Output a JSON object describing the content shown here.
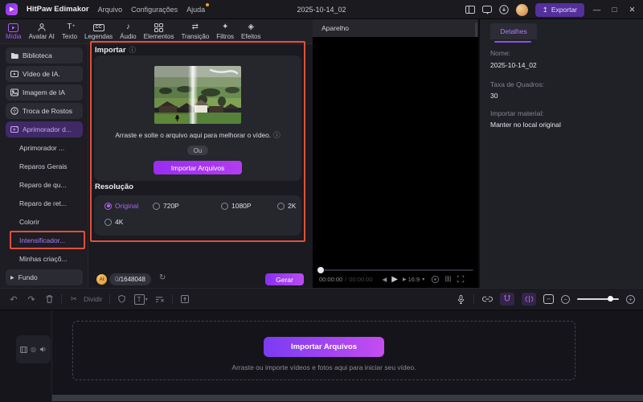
{
  "titlebar": {
    "app_name": "HitPaw Edimakor",
    "menus": [
      "Arquivo",
      "Configurações",
      "Ajuda"
    ],
    "project_title": "2025-10-14_02",
    "export_label": "Exportar"
  },
  "tabs": [
    "Mídia",
    "Avatar AI",
    "Texto",
    "Legendas",
    "Áudio",
    "Elementos",
    "Transição",
    "Filtros",
    "Efeitos"
  ],
  "sidebar": {
    "items": [
      "Biblioteca",
      "Vídeo de IA.",
      "Imagem de IA",
      "Troca de Rostos",
      "Aprimorador d..."
    ],
    "subitems": [
      "Aprimorador ...",
      "Reparos Gerais",
      "Reparo de qu...",
      "Reparo de ret...",
      "Colorir",
      "Intensificador...",
      "Minhas criaçõ...",
      "Fundo"
    ]
  },
  "import_panel": {
    "title": "Importar",
    "drop_text": "Arraste e solte o arquivo aqui para melhorar o vídeo.",
    "or_label": "Ou",
    "import_button": "Importar Arquivos",
    "resolution_title": "Resolução",
    "resolutions": [
      "Original",
      "720P",
      "1080P",
      "2K",
      "4K"
    ],
    "selected_resolution": "Original",
    "coin_label": "AI",
    "credits_used": "0",
    "credits_total": "/1648048",
    "generate_button": "Gerar"
  },
  "preview": {
    "header": "Aparelho",
    "time_current": "00:00:00",
    "time_sep": "/",
    "time_total": "00:00:00",
    "ratio_label": "16:9"
  },
  "details": {
    "tab_label": "Detalhes",
    "fields": [
      {
        "label": "Nome:",
        "value": "2025-10-14_02"
      },
      {
        "label": "Taxa de Quadros:",
        "value": "30"
      },
      {
        "label": "Importar material:",
        "value": "Manter no local original"
      }
    ]
  },
  "toolbar": {
    "divide_label": "Dividir"
  },
  "timeline": {
    "import_button": "Importar Arquivos",
    "drop_hint": "Arraste ou importe vídeos e fotos aqui para iniciar seu vídeo."
  },
  "icons": {
    "audio_note": "♪",
    "transition": "⇄",
    "filters": "✦",
    "effects": "◈",
    "cc": "CC",
    "text_t": "T",
    "plus": "+",
    "undo": "↶",
    "redo": "↷",
    "scissors": "✂",
    "caret_down": "▾",
    "prev_frame": "◀",
    "play": "▶",
    "expand": "▶",
    "grid": "⊞",
    "minus": "−",
    "info": "ⓘ",
    "refresh": "↻",
    "record": "◎",
    "fit": "↔",
    "upload": "↥",
    "minimize": "—",
    "maximize": "□",
    "close": "✕"
  },
  "colors": {
    "accent_purple": "#a361f2",
    "button_gradient_start": "#7b3bf2",
    "button_gradient_end": "#c44df0",
    "annotation_red": "#e1503c",
    "coin_orange": "#e08f2e"
  }
}
